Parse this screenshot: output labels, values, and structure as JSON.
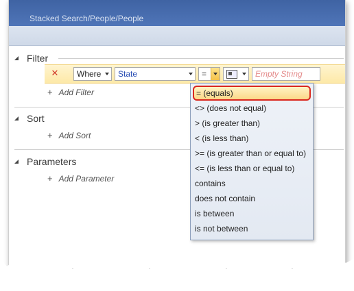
{
  "header": {
    "breadcrumb": "Stacked Search/People/People"
  },
  "sections": {
    "filter": {
      "title": "Filter",
      "add_label": "Add Filter"
    },
    "sort": {
      "title": "Sort",
      "add_label": "Add Sort"
    },
    "parameters": {
      "title": "Parameters",
      "add_label": "Add Parameter"
    }
  },
  "filter_row": {
    "remove_glyph": "✕",
    "conjunction": "Where",
    "field": "State",
    "operator": "=",
    "value_placeholder": "Empty String"
  },
  "operator_menu": {
    "selected_index": 0,
    "items": [
      "= (equals)",
      "<> (does not equal)",
      "> (is greater than)",
      "< (is less than)",
      ">= (is greater than or equal to)",
      "<= (is less than or equal to)",
      "contains",
      "does not contain",
      "is between",
      "is not between"
    ]
  },
  "colors": {
    "highlight_border": "#d9271e",
    "accent_row": "#fde9a8",
    "link": "#2a4fb5"
  }
}
